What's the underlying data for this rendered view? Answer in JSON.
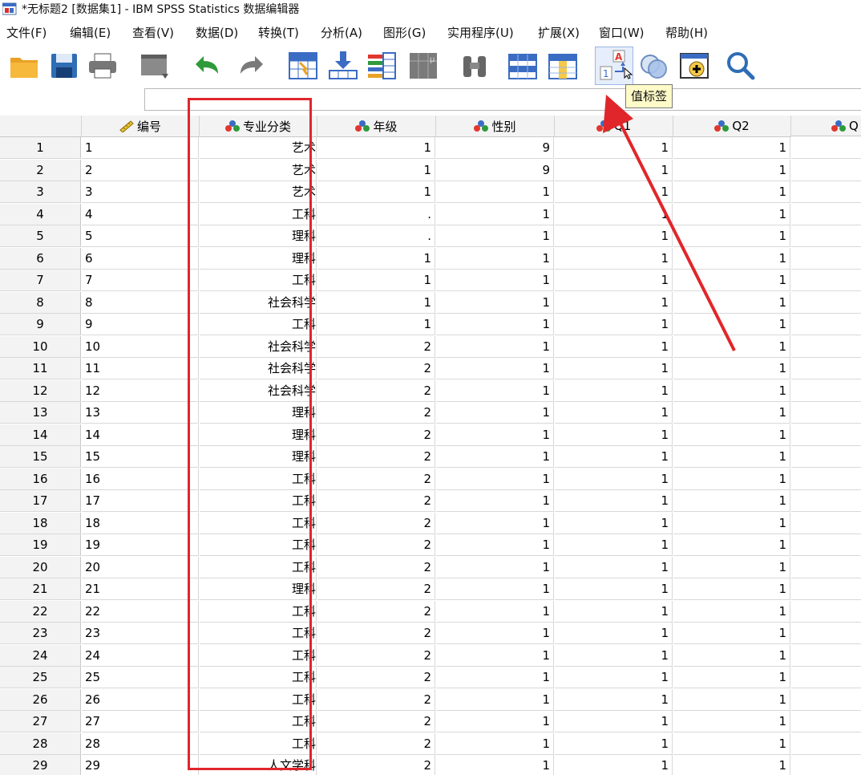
{
  "window": {
    "title": "*无标题2 [数据集1] - IBM SPSS Statistics 数据编辑器"
  },
  "menu": [
    {
      "label": "文件(F)"
    },
    {
      "label": "编辑(E)"
    },
    {
      "label": "查看(V)"
    },
    {
      "label": "数据(D)"
    },
    {
      "label": "转换(T)"
    },
    {
      "label": "分析(A)"
    },
    {
      "label": "图形(G)"
    },
    {
      "label": "实用程序(U)"
    },
    {
      "label": "扩展(X)"
    },
    {
      "label": "窗口(W)"
    },
    {
      "label": "帮助(H)"
    }
  ],
  "toolbar": {
    "icons": [
      "open-folder-icon",
      "save-icon",
      "print-icon",
      "dialog-recall-icon",
      "undo-icon",
      "redo-icon",
      "goto-case-icon",
      "goto-variable-icon",
      "variables-icon",
      "run-descriptives-icon",
      "find-icon",
      "insert-cases-icon",
      "insert-variable-icon",
      "value-labels-icon",
      "use-sets-icon",
      "show-all-variables-icon",
      "search-icon"
    ],
    "tooltip": "值标签"
  },
  "cell_editor": {
    "value": ""
  },
  "columns": [
    {
      "name": "编号",
      "icon": "scale-icon"
    },
    {
      "name": "专业分类",
      "icon": "nominal-icon"
    },
    {
      "name": "年级",
      "icon": "nominal-icon"
    },
    {
      "name": "性别",
      "icon": "nominal-icon"
    },
    {
      "name": "Q1",
      "icon": "nominal-icon"
    },
    {
      "name": "Q2",
      "icon": "nominal-icon"
    },
    {
      "name": "Q",
      "icon": "nominal-icon"
    }
  ],
  "rows": [
    {
      "n": "1",
      "id": "1",
      "major": "艺术",
      "grade": "1",
      "gender": "9",
      "q1": "1",
      "q2": "1"
    },
    {
      "n": "2",
      "id": "2",
      "major": "艺术",
      "grade": "1",
      "gender": "9",
      "q1": "1",
      "q2": "1"
    },
    {
      "n": "3",
      "id": "3",
      "major": "艺术",
      "grade": "1",
      "gender": "1",
      "q1": "1",
      "q2": "1"
    },
    {
      "n": "4",
      "id": "4",
      "major": "工科",
      "grade": ".",
      "gender": "1",
      "q1": "1",
      "q2": "1"
    },
    {
      "n": "5",
      "id": "5",
      "major": "理科",
      "grade": ".",
      "gender": "1",
      "q1": "1",
      "q2": "1"
    },
    {
      "n": "6",
      "id": "6",
      "major": "理科",
      "grade": "1",
      "gender": "1",
      "q1": "1",
      "q2": "1"
    },
    {
      "n": "7",
      "id": "7",
      "major": "工科",
      "grade": "1",
      "gender": "1",
      "q1": "1",
      "q2": "1"
    },
    {
      "n": "8",
      "id": "8",
      "major": "社会科学",
      "grade": "1",
      "gender": "1",
      "q1": "1",
      "q2": "1"
    },
    {
      "n": "9",
      "id": "9",
      "major": "工科",
      "grade": "1",
      "gender": "1",
      "q1": "1",
      "q2": "1"
    },
    {
      "n": "10",
      "id": "10",
      "major": "社会科学",
      "grade": "2",
      "gender": "1",
      "q1": "1",
      "q2": "1"
    },
    {
      "n": "11",
      "id": "11",
      "major": "社会科学",
      "grade": "2",
      "gender": "1",
      "q1": "1",
      "q2": "1"
    },
    {
      "n": "12",
      "id": "12",
      "major": "社会科学",
      "grade": "2",
      "gender": "1",
      "q1": "1",
      "q2": "1"
    },
    {
      "n": "13",
      "id": "13",
      "major": "理科",
      "grade": "2",
      "gender": "1",
      "q1": "1",
      "q2": "1"
    },
    {
      "n": "14",
      "id": "14",
      "major": "理科",
      "grade": "2",
      "gender": "1",
      "q1": "1",
      "q2": "1"
    },
    {
      "n": "15",
      "id": "15",
      "major": "理科",
      "grade": "2",
      "gender": "1",
      "q1": "1",
      "q2": "1"
    },
    {
      "n": "16",
      "id": "16",
      "major": "工科",
      "grade": "2",
      "gender": "1",
      "q1": "1",
      "q2": "1"
    },
    {
      "n": "17",
      "id": "17",
      "major": "工科",
      "grade": "2",
      "gender": "1",
      "q1": "1",
      "q2": "1"
    },
    {
      "n": "18",
      "id": "18",
      "major": "工科",
      "grade": "2",
      "gender": "1",
      "q1": "1",
      "q2": "1"
    },
    {
      "n": "19",
      "id": "19",
      "major": "工科",
      "grade": "2",
      "gender": "1",
      "q1": "1",
      "q2": "1"
    },
    {
      "n": "20",
      "id": "20",
      "major": "工科",
      "grade": "2",
      "gender": "1",
      "q1": "1",
      "q2": "1"
    },
    {
      "n": "21",
      "id": "21",
      "major": "理科",
      "grade": "2",
      "gender": "1",
      "q1": "1",
      "q2": "1"
    },
    {
      "n": "22",
      "id": "22",
      "major": "工科",
      "grade": "2",
      "gender": "1",
      "q1": "1",
      "q2": "1"
    },
    {
      "n": "23",
      "id": "23",
      "major": "工科",
      "grade": "2",
      "gender": "1",
      "q1": "1",
      "q2": "1"
    },
    {
      "n": "24",
      "id": "24",
      "major": "工科",
      "grade": "2",
      "gender": "1",
      "q1": "1",
      "q2": "1"
    },
    {
      "n": "25",
      "id": "25",
      "major": "工科",
      "grade": "2",
      "gender": "1",
      "q1": "1",
      "q2": "1"
    },
    {
      "n": "26",
      "id": "26",
      "major": "工科",
      "grade": "2",
      "gender": "1",
      "q1": "1",
      "q2": "1"
    },
    {
      "n": "27",
      "id": "27",
      "major": "工科",
      "grade": "2",
      "gender": "1",
      "q1": "1",
      "q2": "1"
    },
    {
      "n": "28",
      "id": "28",
      "major": "工科",
      "grade": "2",
      "gender": "1",
      "q1": "1",
      "q2": "1"
    },
    {
      "n": "29",
      "id": "29",
      "major": "人文学科",
      "grade": "2",
      "gender": "1",
      "q1": "1",
      "q2": "1"
    }
  ],
  "colors": {
    "annotation": "#e0262b",
    "header_bg": "#f3f3f3",
    "tooltip_bg": "#fffbc8"
  }
}
